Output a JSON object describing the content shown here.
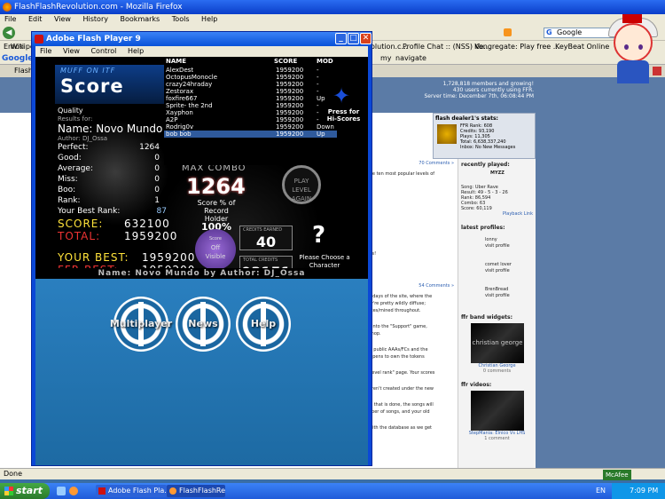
{
  "firefox": {
    "title": "FlashFlashRevolution.com - Mozilla Firefox",
    "menu": [
      "File",
      "Edit",
      "View",
      "History",
      "Bookmarks",
      "Tools",
      "Help"
    ],
    "search_engine": "Google",
    "bookmarks": [
      "Emoti",
      "Wikiped",
      "olution.c...",
      "Profile Chat :: (NSS) Ve...",
      "Kongregate: Play free ...",
      "KeyBeat Online"
    ],
    "google_bar_label": "Google",
    "google_bar_items": [
      "my",
      "navigate"
    ],
    "tab_label": "FlashFlash",
    "status": "Done"
  },
  "site": {
    "header_stats": [
      "1,728,818 members and growing!",
      "430 users currently using FFR.",
      "Server time: December 7th, 06:08:44 PM"
    ],
    "dealer": {
      "title": "flash dealer1's stats:",
      "lines": [
        "FFR Rank: 608",
        "Credits: 93,190",
        "Plays: 11,305",
        "Total: 6,638,337,240",
        "Inbox: No New Messages"
      ]
    },
    "main_lines": [
      "70 Comments »",
      "know the ten most popular levels of",
      "e level is!",
      ", 2010",
      "54 Comments »",
      "earliest days of the site, where the",
      "ult, they're pretty wildly diffuse;",
      "blue notes/mined throughout.",
      "getnea into the \"Support\" game,",
      "e FFR Shop.",
      "ave lost public AAAs/FCs and the",
      "ady happens to own the tokens",
      "\"token level rank\" page. Your scores",
      "that weren't created under the new",
      "nd once that is done, the songs will",
      "ed number of songs, and your old",
      "areful with the database as we get"
    ],
    "recent": {
      "title": "recently played:",
      "song": "MYZZ",
      "lines": [
        "Song: Uber Rave",
        "Result: 49 - 5 - 3 - 26",
        "Rank: 86,594",
        "Combo: 63",
        "Score: 60,119",
        "Playback Link"
      ]
    },
    "profiles": {
      "title": "latest profiles:",
      "items": [
        {
          "name": "lonny",
          "sub": "visit profile"
        },
        {
          "name": "comet lover",
          "sub": "visit profile"
        },
        {
          "name": "BrenBread",
          "sub": "visit profile"
        }
      ]
    },
    "band": {
      "title": "ffr band widgets:",
      "name": "christian george",
      "caption": "Christian George",
      "sub": "0 comments"
    },
    "videos": {
      "title": "ffr videos:",
      "caption": "StepMania: Elnico Vs LHS",
      "sub": "1 comment"
    }
  },
  "flash": {
    "title": "Adobe Flash Player 9",
    "menu": [
      "File",
      "View",
      "Control",
      "Help"
    ],
    "muff_small": "MUFF ON ITF",
    "score_word": "Score",
    "quality_label": "Quality",
    "results_for": "Results for:",
    "song_name": "Name: Novo Mundo",
    "author": "Author: DJ_Ossa",
    "stats": [
      {
        "label": "Perfect:",
        "value": "1264"
      },
      {
        "label": "Good:",
        "value": "0"
      },
      {
        "label": "Average:",
        "value": "0"
      },
      {
        "label": "Miss:",
        "value": "0"
      },
      {
        "label": "Boo:",
        "value": "0"
      },
      {
        "label": "Rank:",
        "value": "1"
      }
    ],
    "best_rank_label": "Your Best Rank:",
    "best_rank_value": "87",
    "score_label": "SCORE:",
    "score_value": "632100",
    "total_label": "TOTAL:",
    "total_value": "1959200",
    "your_best_label": "YOUR BEST:",
    "your_best_value": "1959200",
    "ffr_best_label": "FFR BEST:",
    "ffr_best_value": "1959200",
    "max_combo_label": "MAX COMBO",
    "max_combo_value": "1264",
    "holder_text": "Score % of Record Holder",
    "holder_pct": "100%",
    "visible_top": "Score",
    "visible_mid": "Off",
    "visible_label": "Visible",
    "credits_earned_label": "CREDITS EARNED",
    "credits_earned": "40",
    "total_credits_label": "TOTAL CREDITS",
    "total_credits": "93151",
    "question": "?",
    "choose_text": "Please Choose a Character",
    "again_text": "PLAY LEVEL AGAIN",
    "press_text": "Press for Hi-Scores",
    "caption": "Name: Novo Mundo by Author: DJ_Ossa",
    "buttons": [
      "Multiplayer",
      "News",
      "Help"
    ],
    "board": {
      "headers": [
        "NAME",
        "SCORE",
        "MOD"
      ],
      "rows": [
        {
          "name": "AlexDest",
          "score": "1959200",
          "mod": "-"
        },
        {
          "name": "OctopusMonocle",
          "score": "1959200",
          "mod": "-"
        },
        {
          "name": "crazy24hraday",
          "score": "1959200",
          "mod": "-"
        },
        {
          "name": "Zestorax",
          "score": "1959200",
          "mod": "-"
        },
        {
          "name": "foxfire667",
          "score": "1959200",
          "mod": "Up"
        },
        {
          "name": "Sprite- the 2nd",
          "score": "1959200",
          "mod": "-"
        },
        {
          "name": "Xayphon",
          "score": "1959200",
          "mod": "-"
        },
        {
          "name": "A2P",
          "score": "1959200",
          "mod": "-"
        },
        {
          "name": "Rodrig0v",
          "score": "1959200",
          "mod": "Down"
        },
        {
          "name": "bob bob",
          "score": "1959200",
          "mod": "Up"
        }
      ]
    }
  },
  "taskbar": {
    "start": "start",
    "tasks": [
      "Adobe Flash Pla...",
      "FlashFlashRevol..."
    ],
    "lang": "EN",
    "mcafee": "McAfee",
    "time": "7:09 PM"
  }
}
